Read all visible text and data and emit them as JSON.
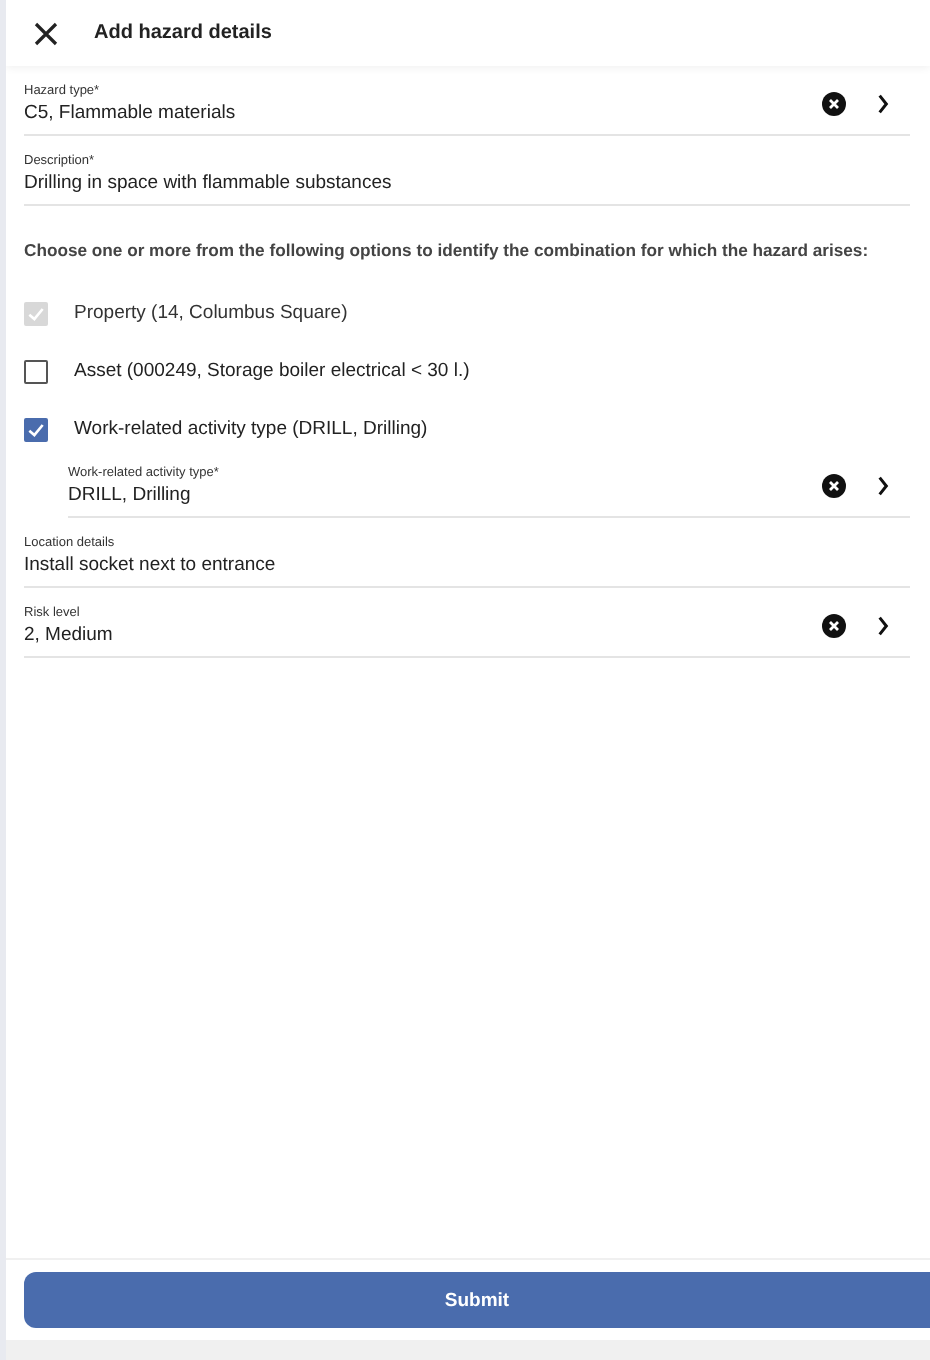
{
  "header": {
    "title": "Add hazard details"
  },
  "fields_top": [
    {
      "kind": "select",
      "label": "Hazard type*",
      "value": "C5, Flammable materials"
    },
    {
      "kind": "text",
      "label": "Description*",
      "value": "Drilling in space with flammable substances"
    }
  ],
  "options_intro": "Choose one or more from the following options to identify the combination for which the hazard arises:",
  "options": [
    {
      "label": "Property (14, Columbus Square)",
      "checked": true,
      "disabled": true
    },
    {
      "label": "Asset (000249, Storage boiler electrical < 30 l.)",
      "checked": false,
      "disabled": false
    },
    {
      "label": "Work-related activity type (DRILL, Drilling)",
      "checked": true,
      "disabled": false,
      "field": {
        "kind": "select",
        "label": "Work-related activity type*",
        "value": "DRILL, Drilling"
      }
    }
  ],
  "fields_bottom": [
    {
      "kind": "text",
      "label": "Location details",
      "value": "Install socket next to entrance"
    },
    {
      "kind": "select",
      "label": "Risk level",
      "value": "2, Medium"
    }
  ],
  "submit": "Submit"
}
